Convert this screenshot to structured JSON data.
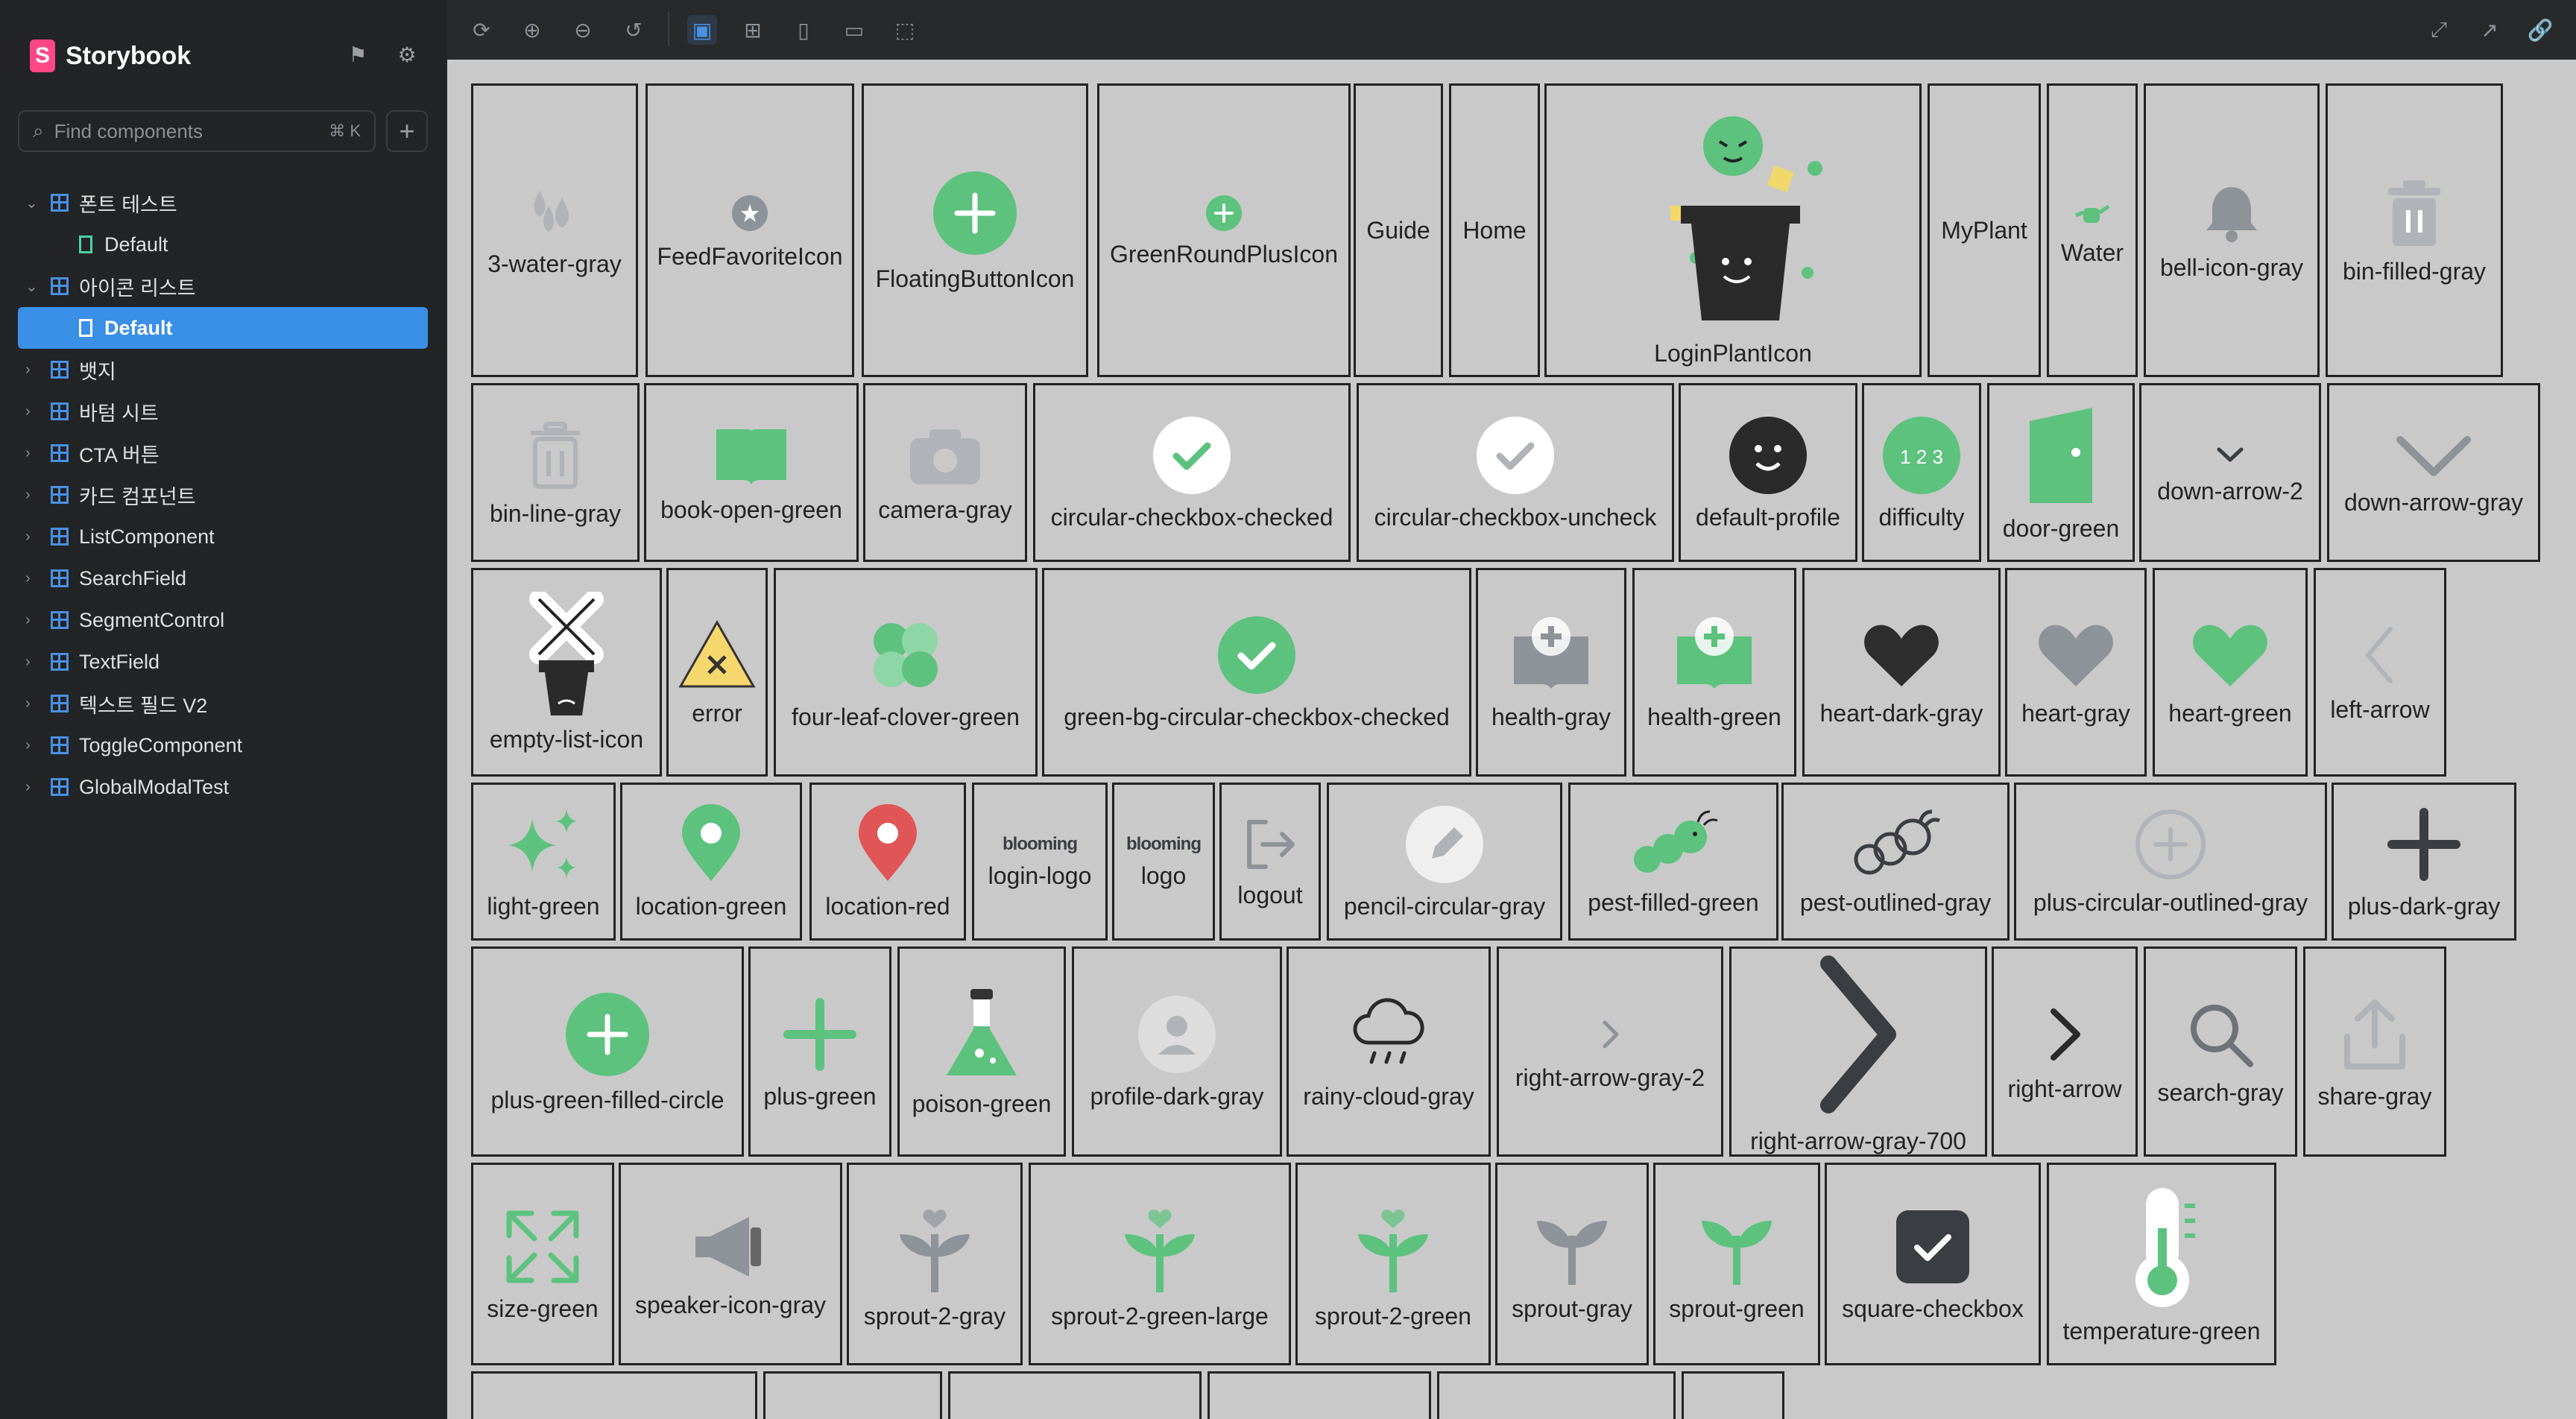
{
  "app": {
    "title": "Storybook"
  },
  "search": {
    "placeholder": "Find components",
    "shortcut": "⌘ K"
  },
  "tree": [
    {
      "type": "group",
      "label": "폰트 테스트",
      "expanded": true
    },
    {
      "type": "story",
      "label": "Default"
    },
    {
      "type": "group",
      "label": "아이콘 리스트",
      "expanded": true
    },
    {
      "type": "story",
      "label": "Default",
      "active": true
    },
    {
      "type": "group",
      "label": "뱃지"
    },
    {
      "type": "group",
      "label": "바텀 시트"
    },
    {
      "type": "group",
      "label": "CTA 버튼"
    },
    {
      "type": "group",
      "label": "카드 컴포넌트"
    },
    {
      "type": "group",
      "label": "ListComponent"
    },
    {
      "type": "group",
      "label": "SearchField"
    },
    {
      "type": "group",
      "label": "SegmentControl"
    },
    {
      "type": "group",
      "label": "TextField"
    },
    {
      "type": "group",
      "label": "텍스트 필드 V2"
    },
    {
      "type": "group",
      "label": "ToggleComponent"
    },
    {
      "type": "group",
      "label": "GlobalModalTest"
    }
  ],
  "colors": {
    "green": "#5cc27e",
    "gray": "#8e939a",
    "darkgray": "#3a3d42",
    "red": "#e05555",
    "canvas": "#c9c9c9",
    "accent": "#3a8fe6"
  },
  "icons": [
    {
      "label": "3-water-gray",
      "shape": "drops",
      "color": "#b0b4b8"
    },
    {
      "label": "FeedFavoriteIcon",
      "shape": "star-circle",
      "color": "#8e939a"
    },
    {
      "label": "FloatingButtonIcon",
      "shape": "plus-circle",
      "color": "#5cc27e"
    },
    {
      "label": "GreenRoundPlusIcon",
      "shape": "plus-circle-small",
      "color": "#5cc27e"
    },
    {
      "label": "Guide",
      "shape": "none"
    },
    {
      "label": "Home",
      "shape": "none"
    },
    {
      "label": "LoginPlantIcon",
      "shape": "pot",
      "color": "#2a2a2a"
    },
    {
      "label": "MyPlant",
      "shape": "none"
    },
    {
      "label": "Water",
      "shape": "watering-can",
      "color": "#5cc27e"
    },
    {
      "label": "bell-icon-gray",
      "shape": "bell",
      "color": "#8e939a"
    },
    {
      "label": "bin-filled-gray",
      "shape": "bin",
      "color": "#b0b4b8"
    },
    {
      "label": "bin-line-gray",
      "shape": "bin-outline",
      "color": "#b0b4b8"
    },
    {
      "label": "book-open-green",
      "shape": "book",
      "color": "#5cc27e"
    },
    {
      "label": "camera-gray",
      "shape": "camera",
      "color": "#b0b4b8"
    },
    {
      "label": "circular-checkbox-checked",
      "shape": "check-white",
      "color": "#5cc27e"
    },
    {
      "label": "circular-checkbox-uncheck",
      "shape": "check-white",
      "color": "#b0b4b8"
    },
    {
      "label": "default-profile",
      "shape": "face",
      "color": "#2a2a2a"
    },
    {
      "label": "difficulty",
      "shape": "difficulty",
      "color": "#5cc27e"
    },
    {
      "label": "door-green",
      "shape": "door",
      "color": "#5cc27e"
    },
    {
      "label": "down-arrow-2",
      "shape": "chev-down-small",
      "color": "#3a3d42"
    },
    {
      "label": "down-arrow-gray",
      "shape": "chev-down",
      "color": "#8e939a"
    },
    {
      "label": "empty-list-icon",
      "shape": "empty-pot",
      "color": "#2a2a2a"
    },
    {
      "label": "error",
      "shape": "warning",
      "color": "#f5d76e"
    },
    {
      "label": "four-leaf-clover-green",
      "shape": "clover",
      "color": "#5cc27e"
    },
    {
      "label": "green-bg-circular-checkbox-checked",
      "shape": "check-green",
      "color": "#5cc27e"
    },
    {
      "label": "health-gray",
      "shape": "health",
      "color": "#8e939a"
    },
    {
      "label": "health-green",
      "shape": "health",
      "color": "#5cc27e"
    },
    {
      "label": "heart-dark-gray",
      "shape": "heart",
      "color": "#2e2e2e"
    },
    {
      "label": "heart-gray",
      "shape": "heart",
      "color": "#8e939a"
    },
    {
      "label": "heart-green",
      "shape": "heart",
      "color": "#5cc27e"
    },
    {
      "label": "left-arrow",
      "shape": "chev-left",
      "color": "#b0b4b8"
    },
    {
      "label": "light-green",
      "shape": "sparkle",
      "color": "#5cc27e"
    },
    {
      "label": "location-green",
      "shape": "pin",
      "color": "#5cc27e"
    },
    {
      "label": "location-red",
      "shape": "pin",
      "color": "#e05555"
    },
    {
      "label": "login-logo",
      "shape": "wordmark",
      "text": "blooming",
      "color": "#3a3d42"
    },
    {
      "label": "logo",
      "shape": "wordmark",
      "text": "blooming",
      "color": "#3a3d42"
    },
    {
      "label": "logout",
      "shape": "logout",
      "color": "#8e939a"
    },
    {
      "label": "pencil-circular-gray",
      "shape": "pencil",
      "color": "#b0b4b8"
    },
    {
      "label": "pest-filled-green",
      "shape": "pest",
      "color": "#5cc27e"
    },
    {
      "label": "pest-outlined-gray",
      "shape": "pest-outline",
      "color": "#3a3d42"
    },
    {
      "label": "plus-circular-outlined-gray",
      "shape": "plus-outline",
      "color": "#b0b4b8"
    },
    {
      "label": "plus-dark-gray",
      "shape": "plus",
      "color": "#3a3d42"
    },
    {
      "label": "plus-green-filled-circle",
      "shape": "plus-circle",
      "color": "#5cc27e"
    },
    {
      "label": "plus-green",
      "shape": "plus",
      "color": "#5cc27e"
    },
    {
      "label": "poison-green",
      "shape": "flask",
      "color": "#5cc27e"
    },
    {
      "label": "profile-dark-gray",
      "shape": "profile",
      "color": "#b0b4b8"
    },
    {
      "label": "rainy-cloud-gray",
      "shape": "cloud",
      "color": "#2a2a2a"
    },
    {
      "label": "right-arrow-gray-2",
      "shape": "chev-right-small",
      "color": "#8e939a"
    },
    {
      "label": "right-arrow-gray-700",
      "shape": "chev-right-big",
      "color": "#3a3d42"
    },
    {
      "label": "right-arrow",
      "shape": "chev-right",
      "color": "#2a2a2a"
    },
    {
      "label": "search-gray",
      "shape": "search",
      "color": "#6e737a"
    },
    {
      "label": "share-gray",
      "shape": "share",
      "color": "#b0b4b8"
    },
    {
      "label": "size-green",
      "shape": "expand",
      "color": "#5cc27e"
    },
    {
      "label": "speaker-icon-gray",
      "shape": "speaker",
      "color": "#8e939a"
    },
    {
      "label": "sprout-2-gray",
      "shape": "sprout-heart",
      "color": "#8e939a"
    },
    {
      "label": "sprout-2-green-large",
      "shape": "sprout-heart",
      "color": "#5cc27e"
    },
    {
      "label": "sprout-2-green",
      "shape": "sprout-heart",
      "color": "#5cc27e"
    },
    {
      "label": "sprout-gray",
      "shape": "sprout",
      "color": "#8e939a"
    },
    {
      "label": "sprout-green",
      "shape": "sprout",
      "color": "#5cc27e"
    },
    {
      "label": "square-checkbox",
      "shape": "square-check",
      "color": "#3a3d42"
    },
    {
      "label": "temperature-green",
      "shape": "thermo",
      "color": "#5cc27e"
    }
  ]
}
